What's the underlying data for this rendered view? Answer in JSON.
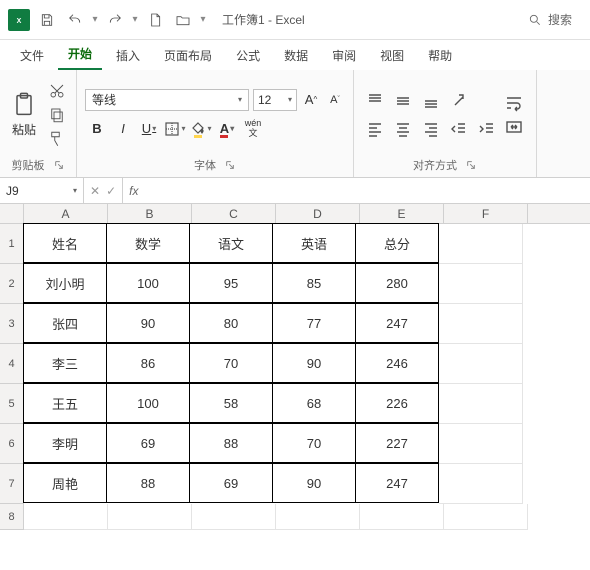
{
  "title": "工作簿1 - Excel",
  "search_placeholder": "搜索",
  "tabs": {
    "file": "文件",
    "home": "开始",
    "insert": "插入",
    "layout": "页面布局",
    "formulas": "公式",
    "data": "数据",
    "review": "审阅",
    "view": "视图",
    "help": "帮助"
  },
  "ribbon": {
    "clipboard": {
      "paste": "粘贴",
      "label": "剪贴板"
    },
    "font": {
      "name": "等线",
      "size": "12",
      "label": "字体",
      "wen": "wén"
    },
    "align": {
      "label": "对齐方式"
    }
  },
  "namebox": "J9",
  "fx": "fx",
  "columns": [
    "A",
    "B",
    "C",
    "D",
    "E",
    "F"
  ],
  "rownums": [
    "1",
    "2",
    "3",
    "4",
    "5",
    "6",
    "7",
    "8"
  ],
  "chart_data": {
    "type": "table",
    "headers": [
      "姓名",
      "数学",
      "语文",
      "英语",
      "总分"
    ],
    "rows": [
      [
        "刘小明",
        100,
        95,
        85,
        280
      ],
      [
        "张四",
        90,
        80,
        77,
        247
      ],
      [
        "李三",
        86,
        70,
        90,
        246
      ],
      [
        "王五",
        100,
        58,
        68,
        226
      ],
      [
        "李明",
        69,
        88,
        70,
        227
      ],
      [
        "周艳",
        88,
        69,
        90,
        247
      ]
    ]
  }
}
